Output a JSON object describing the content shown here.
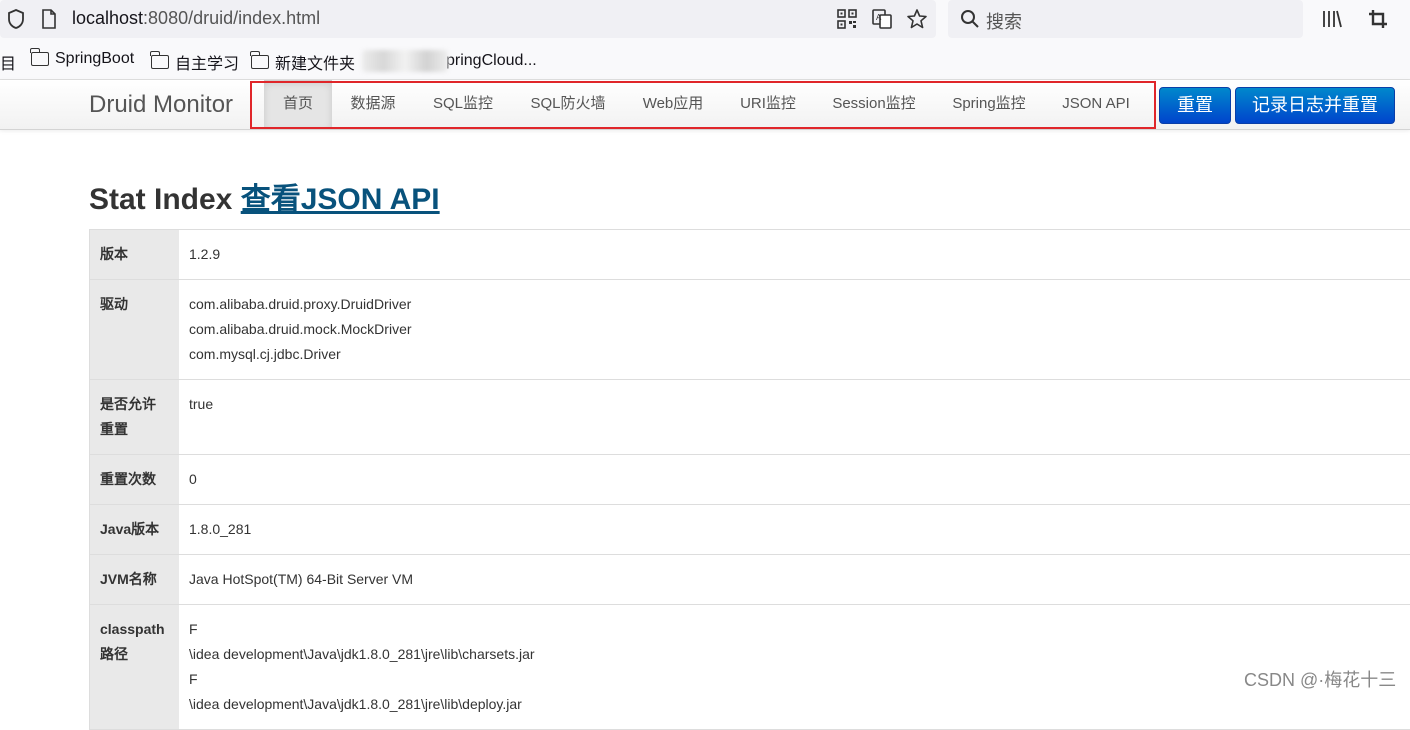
{
  "browser": {
    "url_host": "localhost",
    "url_rest": ":8080/druid/index.html",
    "search_placeholder": "搜索"
  },
  "bookmarks": {
    "first_label": "目",
    "items": [
      "SpringBoot",
      "自主学习",
      "新建文件夹"
    ],
    "partial_item": "pringCloud..."
  },
  "navbar": {
    "brand": "Druid Monitor",
    "items": [
      "首页",
      "数据源",
      "SQL监控",
      "SQL防火墙",
      "Web应用",
      "URI监控",
      "Session监控",
      "Spring监控",
      "JSON API"
    ],
    "reset_label": "重置",
    "log_reset_label": "记录日志并重置"
  },
  "main": {
    "title": "Stat Index",
    "title_link": "查看JSON API",
    "rows": [
      {
        "label": "版本",
        "values": [
          "1.2.9"
        ]
      },
      {
        "label": "驱动",
        "values": [
          "com.alibaba.druid.proxy.DruidDriver",
          "com.alibaba.druid.mock.MockDriver",
          "com.mysql.cj.jdbc.Driver"
        ]
      },
      {
        "label": "是否允许重置",
        "values": [
          "true"
        ]
      },
      {
        "label": "重置次数",
        "values": [
          "0"
        ]
      },
      {
        "label": "Java版本",
        "values": [
          "1.8.0_281"
        ]
      },
      {
        "label": "JVM名称",
        "values": [
          "Java HotSpot(TM) 64-Bit Server VM"
        ]
      },
      {
        "label": "classpath路径",
        "values": [
          "F",
          "\\idea development\\Java\\jdk1.8.0_281\\jre\\lib\\charsets.jar",
          "F",
          "\\idea development\\Java\\jdk1.8.0_281\\jre\\lib\\deploy.jar"
        ]
      }
    ]
  },
  "watermark": "CSDN @·梅花十三",
  "colors": {
    "highlight_box": "#e0262a",
    "primary_button": "#0074cc",
    "link": "#08527c"
  }
}
